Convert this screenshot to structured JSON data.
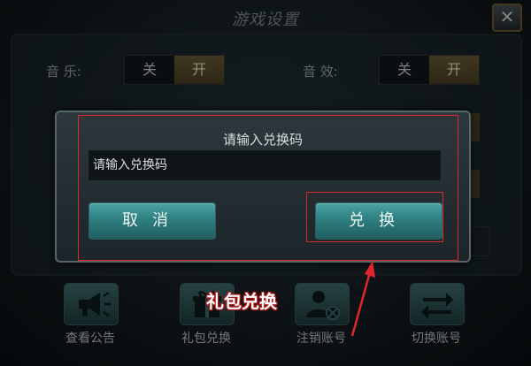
{
  "window": {
    "title": "游戏设置",
    "close_label": "✕"
  },
  "settings": {
    "music": {
      "label": "音  乐:",
      "off": "关",
      "on": "开"
    },
    "sfx": {
      "label": "音  效:",
      "off": "关",
      "on": "开"
    }
  },
  "dialog": {
    "title": "请输入兑换码",
    "input_placeholder": "请输入兑换码",
    "cancel_label": "取消",
    "redeem_label": "兑换"
  },
  "actions": [
    {
      "label": "查看公告",
      "icon": "megaphone-icon"
    },
    {
      "label": "礼包兑换",
      "icon": "gift-icon"
    },
    {
      "label": "注销账号",
      "icon": "user-cancel-icon"
    },
    {
      "label": "切换账号",
      "icon": "switch-arrows-icon"
    }
  ],
  "annotation": {
    "callout": "礼包兑换",
    "color": "#e0262b"
  }
}
